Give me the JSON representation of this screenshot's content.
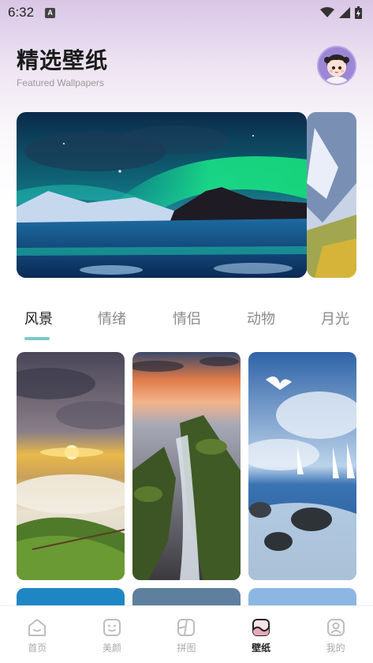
{
  "status_bar": {
    "time": "6:32",
    "notification_letter": "A"
  },
  "header": {
    "title": "精选壁纸",
    "subtitle": "Featured Wallpapers"
  },
  "tabs": [
    {
      "label": "风景",
      "active": true
    },
    {
      "label": "情绪",
      "active": false
    },
    {
      "label": "情侣",
      "active": false
    },
    {
      "label": "动物",
      "active": false
    },
    {
      "label": "月光",
      "active": false
    }
  ],
  "bottom_nav": [
    {
      "label": "首页",
      "icon": "home-face-icon",
      "active": false
    },
    {
      "label": "美颜",
      "icon": "beauty-face-icon",
      "active": false
    },
    {
      "label": "拼图",
      "icon": "collage-icon",
      "active": false
    },
    {
      "label": "壁纸",
      "icon": "wallpaper-icon",
      "active": true
    },
    {
      "label": "我的",
      "icon": "profile-icon",
      "active": false
    }
  ],
  "colors": {
    "accent": "#7cc9c9",
    "active_nav_icon": "#e7a9b8"
  }
}
